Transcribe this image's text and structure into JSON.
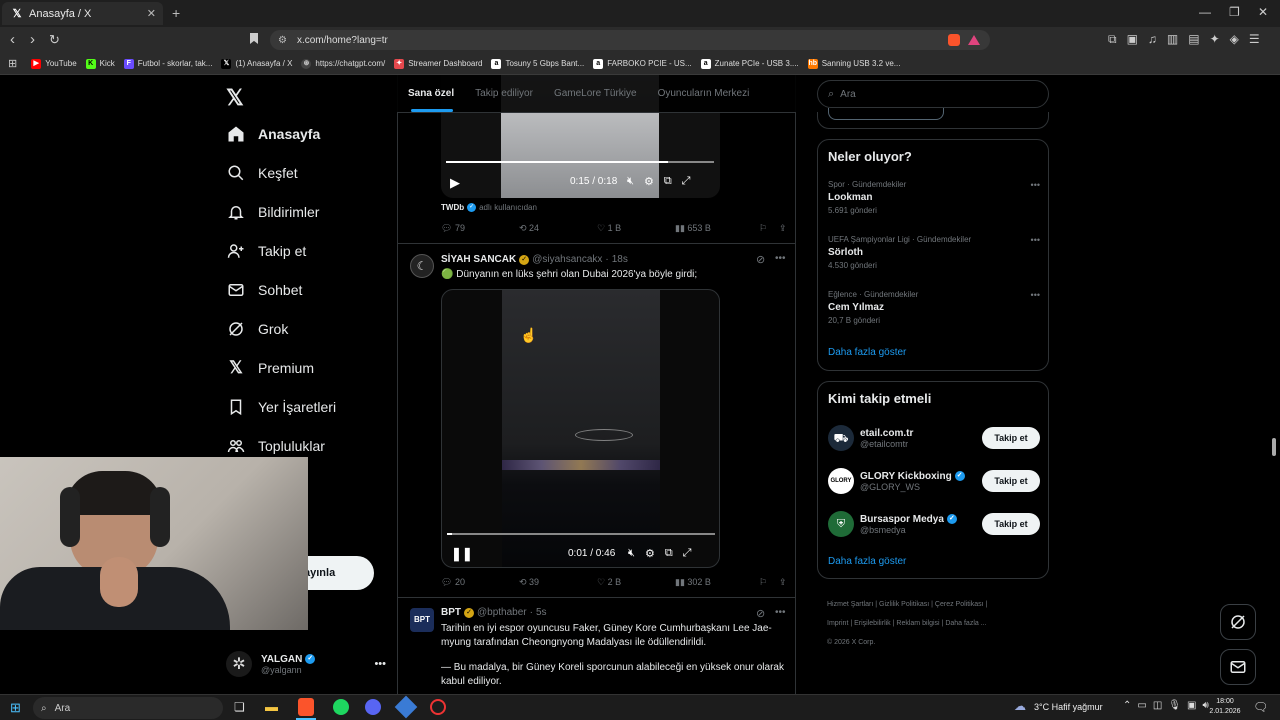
{
  "browser": {
    "tab_title": "Anasayfa / X",
    "url": "x.com/home?lang=tr",
    "bookmarks": [
      {
        "label": "YouTube",
        "icon": "youtube-icon",
        "color": "#ff0000"
      },
      {
        "label": "Kick",
        "icon": "kick-icon",
        "color": "#53fc18"
      },
      {
        "label": "Futbol - skorlar, tak...",
        "icon": "futbol-icon",
        "color": "#6a4cff"
      },
      {
        "label": "(1) Anasayfa / X",
        "icon": "x-icon",
        "color": "#ffffff"
      },
      {
        "label": "https://chatgpt.com/",
        "icon": "chatgpt-icon",
        "color": "#cccccc"
      },
      {
        "label": "Streamer Dashboard",
        "icon": "streamer-icon",
        "color": "#e5484d"
      },
      {
        "label": "Tosuny 5 Gbps Bant...",
        "icon": "amazon-icon",
        "color": "#ffffff"
      },
      {
        "label": "FARBOKO PCIE - US...",
        "icon": "amazon-icon",
        "color": "#ffffff"
      },
      {
        "label": "Zunate PCIe - USB 3....",
        "icon": "amazon-icon",
        "color": "#ffffff"
      },
      {
        "label": "Sanning USB 3.2 ve...",
        "icon": "hb-icon",
        "color": "#ff7a00"
      }
    ]
  },
  "nav": {
    "items": [
      {
        "label": "Anasayfa",
        "icon": "home-icon"
      },
      {
        "label": "Keşfet",
        "icon": "search-icon"
      },
      {
        "label": "Bildirimler",
        "icon": "bell-icon"
      },
      {
        "label": "Takip et",
        "icon": "add-user-icon"
      },
      {
        "label": "Sohbet",
        "icon": "mail-icon"
      },
      {
        "label": "Grok",
        "icon": "grok-icon"
      },
      {
        "label": "Premium",
        "icon": "x-icon"
      },
      {
        "label": "Yer İşaretleri",
        "icon": "bookmark-icon"
      },
      {
        "label": "Topluluklar",
        "icon": "communities-icon"
      }
    ],
    "more_partial": "zla",
    "post_partial": "ayınla",
    "user": {
      "name": "YALGAN",
      "handle": "@yalgann"
    }
  },
  "feed": {
    "tabs": [
      "Sana özel",
      "Takip ediliyor",
      "GameLore Türkiye",
      "Oyuncuların Merkezi"
    ],
    "post0": {
      "time": "0:15 / 0:18",
      "progress": 0.83,
      "source": "TWDb",
      "source_suffix": "adlı kullanıcıdan",
      "replies": "79",
      "reposts": "24",
      "likes": "1 B",
      "views": "653 B"
    },
    "post1": {
      "name": "SİYAH SANCAK",
      "handle": "@siyahsancakx",
      "age": "18s",
      "text": "🟢 Dünyanın en lüks şehri olan Dubai 2026'ya böyle girdi;",
      "time": "0:01 / 0:46",
      "progress": 0.02,
      "replies": "20",
      "reposts": "39",
      "likes": "2 B",
      "views": "302 B"
    },
    "post2": {
      "name": "BPT",
      "handle": "@bpthaber",
      "age": "5s",
      "text1": "Tarihin en iyi espor oyuncusu Faker, Güney Kore Cumhurbaşkanı Lee Jae-myung tarafından Cheongnyong Madalyası ile ödüllendirildi.",
      "text2": "— Bu madalya, bir Güney Koreli sporcunun alabileceği en yüksek onur olarak kabul ediliyor."
    }
  },
  "sidebar": {
    "search_placeholder": "Ara",
    "trends_title": "Neler oluyor?",
    "trends": [
      {
        "category": "Spor · Gündemdekiler",
        "name": "Lookman",
        "count": "5.691 gönderi"
      },
      {
        "category": "UEFA Şampiyonlar Ligi · Gündemdekiler",
        "name": "Sörloth",
        "count": "4.530 gönderi"
      },
      {
        "category": "Eğlence · Gündemdekiler",
        "name": "Cem Yılmaz",
        "count": "20,7 B gönderi"
      }
    ],
    "show_more": "Daha fazla göster",
    "who_title": "Kimi takip etmeli",
    "who": [
      {
        "name": "etail.com.tr",
        "handle": "@etailcomtr",
        "button": "Takip et",
        "verified": false
      },
      {
        "name": "GLORY Kickboxing",
        "handle": "@GLORY_WS",
        "button": "Takip et",
        "verified": true
      },
      {
        "name": "Bursaspor Medya",
        "handle": "@bsmedya",
        "button": "Takip et",
        "verified": true
      }
    ],
    "who_more": "Daha fazla göster",
    "footer": [
      "Hizmet Şartları",
      "Gizlilik Politikası",
      "Çerez Politikası",
      "Imprint",
      "Erişilebilirlik",
      "Reklam bilgisi",
      "Daha fazla ..."
    ],
    "copyright": "© 2026 X Corp."
  },
  "taskbar": {
    "search": "Ara",
    "weather": "3°C  Hafif yağmur",
    "time": "18:00",
    "date": "2.01.2026"
  },
  "colors": {
    "accent": "#1d9bf0",
    "bg": "#000000",
    "border": "#2f3336"
  }
}
